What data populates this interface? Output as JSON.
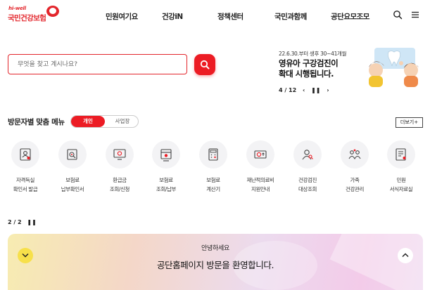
{
  "header": {
    "logo": {
      "tagline": "hi-well",
      "name": "국민건강보험"
    },
    "nav": [
      "민원여기요",
      "건강iN",
      "정책센터",
      "국민과함께",
      "공단요모조모"
    ],
    "icons": [
      "search-icon",
      "hamburger-menu-icon"
    ]
  },
  "search": {
    "placeholder": "무엇을 찾고 계시나요?",
    "value": "",
    "button_icon": "search-icon"
  },
  "banner": {
    "date_text": "22.6.30.부터 생후 30~41개월",
    "title_line1": "영유아 구강검진이",
    "title_line2": "확대 시행됩니다.",
    "page_indicator": "4 / 12",
    "controls": [
      "prev-icon",
      "pause-icon",
      "next-icon"
    ]
  },
  "visitor_menu": {
    "title": "방문자별 맞춤 메뉴",
    "tabs": [
      {
        "label": "개인",
        "active": true
      },
      {
        "label": "사업장",
        "active": false
      }
    ],
    "more_label": "더보기+",
    "items": [
      {
        "label": "자격득실\n확인서 발급",
        "icon": "id-card-icon"
      },
      {
        "label": "보험료\n납부확인서",
        "icon": "document-search-icon"
      },
      {
        "label": "환급금\n조회/신청",
        "icon": "monitor-refund-icon"
      },
      {
        "label": "보험료\n조회/납부",
        "icon": "calendar-payment-icon"
      },
      {
        "label": "보험료\n계산기",
        "icon": "calculator-icon"
      },
      {
        "label": "재난적의료비\n지원안내",
        "icon": "coin-support-icon"
      },
      {
        "label": "건강검진\n대상조회",
        "icon": "person-search-icon"
      },
      {
        "label": "가족\n건강관리",
        "icon": "family-icon"
      },
      {
        "label": "민원\n서식자료실",
        "icon": "form-document-icon"
      }
    ],
    "pager": "2 / 2"
  },
  "welcome": {
    "subtitle": "안녕하세요",
    "message": "공단홈페이지 방문을 환영합니다.",
    "colors": {
      "left_button": "#f7e04a",
      "right_button": "#ffffff"
    }
  },
  "colors": {
    "brand_red": "#e3262c",
    "accent_red": "#ec1c24"
  }
}
